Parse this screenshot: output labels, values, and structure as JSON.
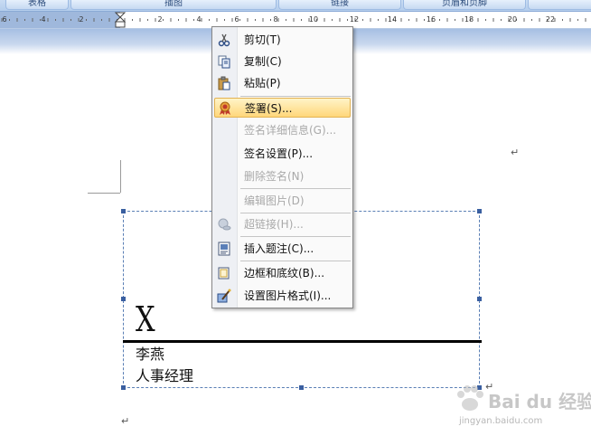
{
  "ribbon": {
    "groups": [
      "表格",
      "插图",
      "链接",
      "页眉和页脚"
    ]
  },
  "ruler": {
    "numbers": [
      "6",
      "4",
      "2",
      "2",
      "4",
      "6",
      "8",
      "10",
      "12",
      "14",
      "16",
      "18",
      "20",
      "22"
    ]
  },
  "document": {
    "signature_mark": "X",
    "signer_name": "李燕",
    "signer_title": "人事经理",
    "paragraph_mark": "↵"
  },
  "context_menu": {
    "items": [
      {
        "label": "剪切(T)",
        "icon": "scissors-icon",
        "enabled": true
      },
      {
        "label": "复制(C)",
        "icon": "copy-icon",
        "enabled": true
      },
      {
        "label": "粘贴(P)",
        "icon": "paste-icon",
        "enabled": true
      },
      {
        "label": "签署(S)...",
        "icon": "sign-ribbon-icon",
        "enabled": true,
        "highlighted": true
      },
      {
        "label": "签名详细信息(G)...",
        "icon": "",
        "enabled": false
      },
      {
        "label": "签名设置(P)...",
        "icon": "",
        "enabled": true
      },
      {
        "label": "删除签名(N)",
        "icon": "",
        "enabled": false
      },
      {
        "label": "编辑图片(D)",
        "icon": "",
        "enabled": false
      },
      {
        "label": "超链接(H)...",
        "icon": "hyperlink-icon",
        "enabled": false
      },
      {
        "label": "插入题注(C)...",
        "icon": "caption-icon",
        "enabled": true
      },
      {
        "label": "边框和底纹(B)...",
        "icon": "border-icon",
        "enabled": true
      },
      {
        "label": "设置图片格式(I)...",
        "icon": "format-picture-icon",
        "enabled": true
      }
    ],
    "hover_color": "#ffd77a"
  },
  "watermark": {
    "text": "Bai du 经验",
    "url": "jingyan.baidu.com"
  }
}
